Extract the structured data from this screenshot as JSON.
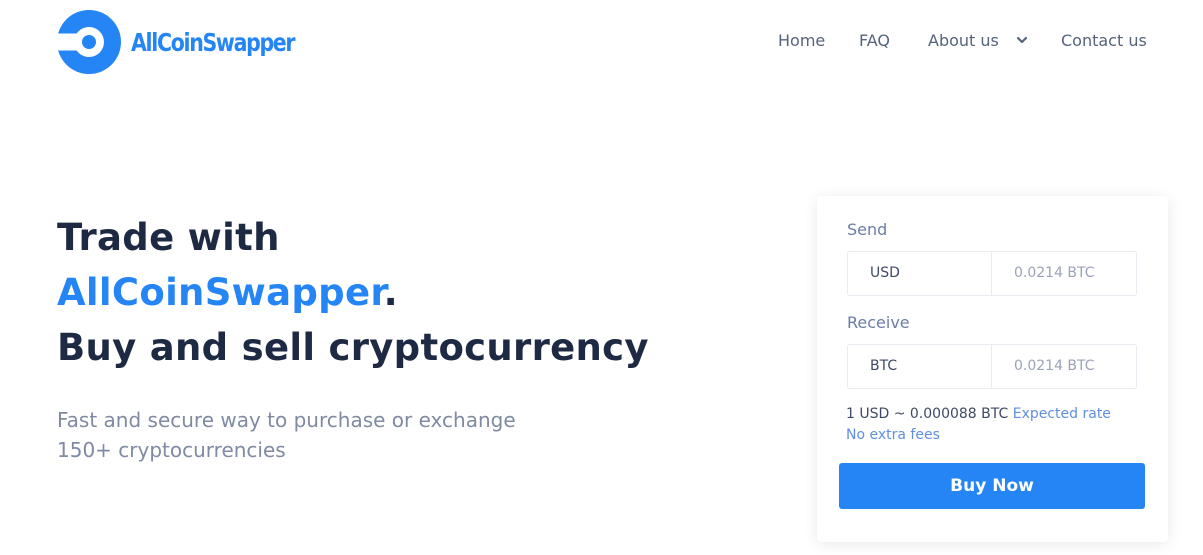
{
  "brand": {
    "name": "AllCoinSwapper",
    "logo_icon": "target-ring-icon",
    "color": "#2585f5"
  },
  "nav": {
    "items": [
      {
        "label": "Home"
      },
      {
        "label": "FAQ"
      },
      {
        "label": "About us",
        "icon": "chevron-down-icon"
      },
      {
        "label": "Contact us"
      }
    ]
  },
  "hero": {
    "title_line1": "Trade with",
    "title_brand": "AllCoinSwapper",
    "title_period": ".",
    "title_line3": "Buy and sell cryptocurrency",
    "subtitle_line1": "Fast and secure way to purchase or exchange",
    "subtitle_line2": "150+ cryptocurrencies"
  },
  "exchange": {
    "send": {
      "label": "Send",
      "currency": "USD",
      "amount": "0.0214 BTC"
    },
    "receive": {
      "label": "Receive",
      "currency": "BTC",
      "amount": "0.0214 BTC"
    },
    "rate_text": "1 USD ~ 0.000088 BTC",
    "rate_link": "Expected rate",
    "fees_note": "No extra fees",
    "buy_label": "Buy Now"
  },
  "colors": {
    "accent": "#2585f5",
    "heading": "#1e2a44",
    "muted": "#7f8aa3",
    "link": "#5f8fe0"
  }
}
